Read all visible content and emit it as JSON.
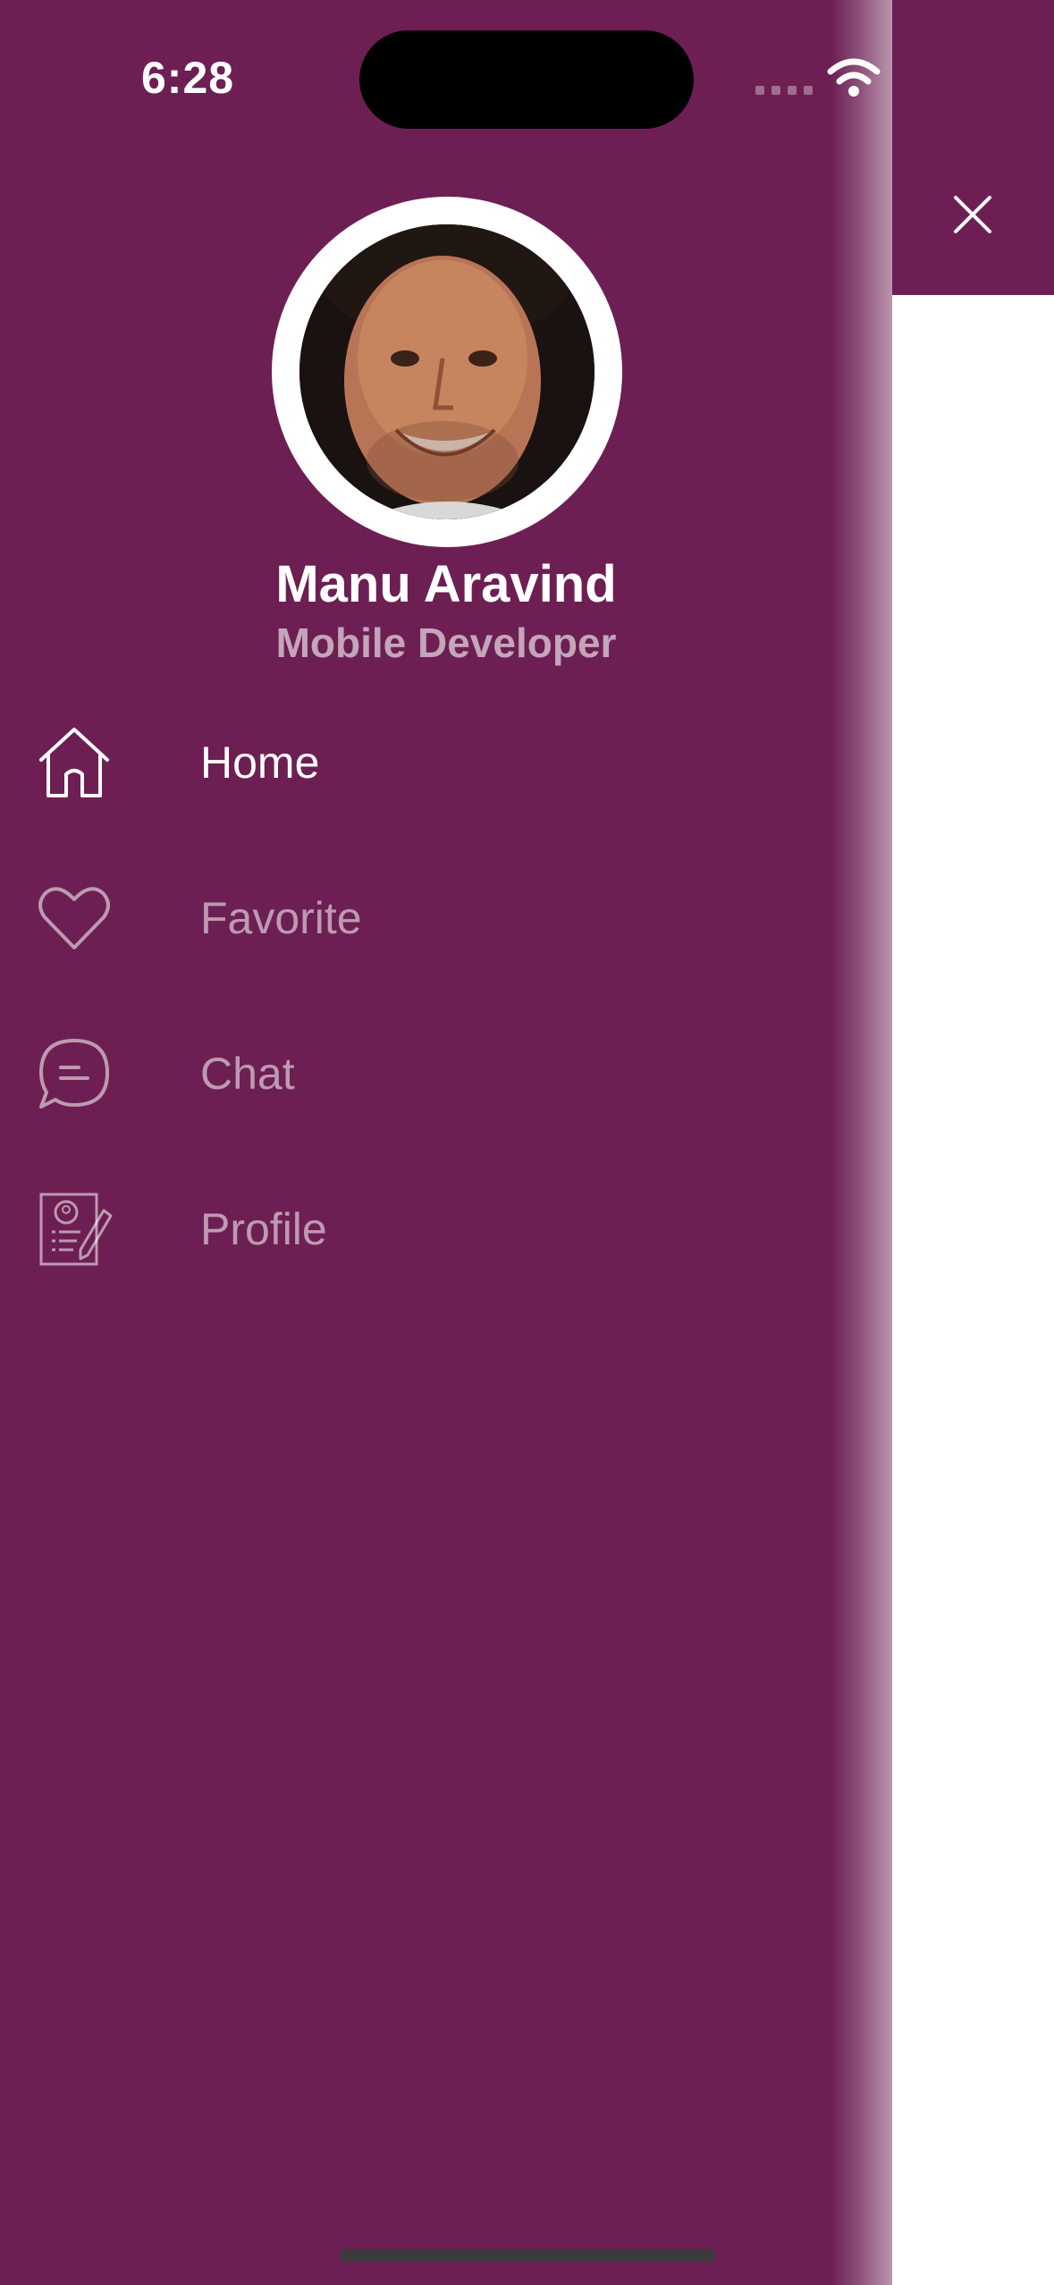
{
  "status_bar": {
    "time": "6:28"
  },
  "profile": {
    "name": "Manu Aravind",
    "role": "Mobile Developer"
  },
  "menu": {
    "items": [
      {
        "label": "Home",
        "icon": "home-icon",
        "active": true
      },
      {
        "label": "Favorite",
        "icon": "heart-icon",
        "active": false
      },
      {
        "label": "Chat",
        "icon": "chat-icon",
        "active": false
      },
      {
        "label": "Profile",
        "icon": "profile-document-icon",
        "active": false
      }
    ]
  },
  "close": {
    "icon": "close-icon"
  },
  "colors": {
    "drawer_background": "#6d1f53",
    "active_text": "#ffffff",
    "inactive_text": "rgba(255,255,255,0.55)"
  }
}
